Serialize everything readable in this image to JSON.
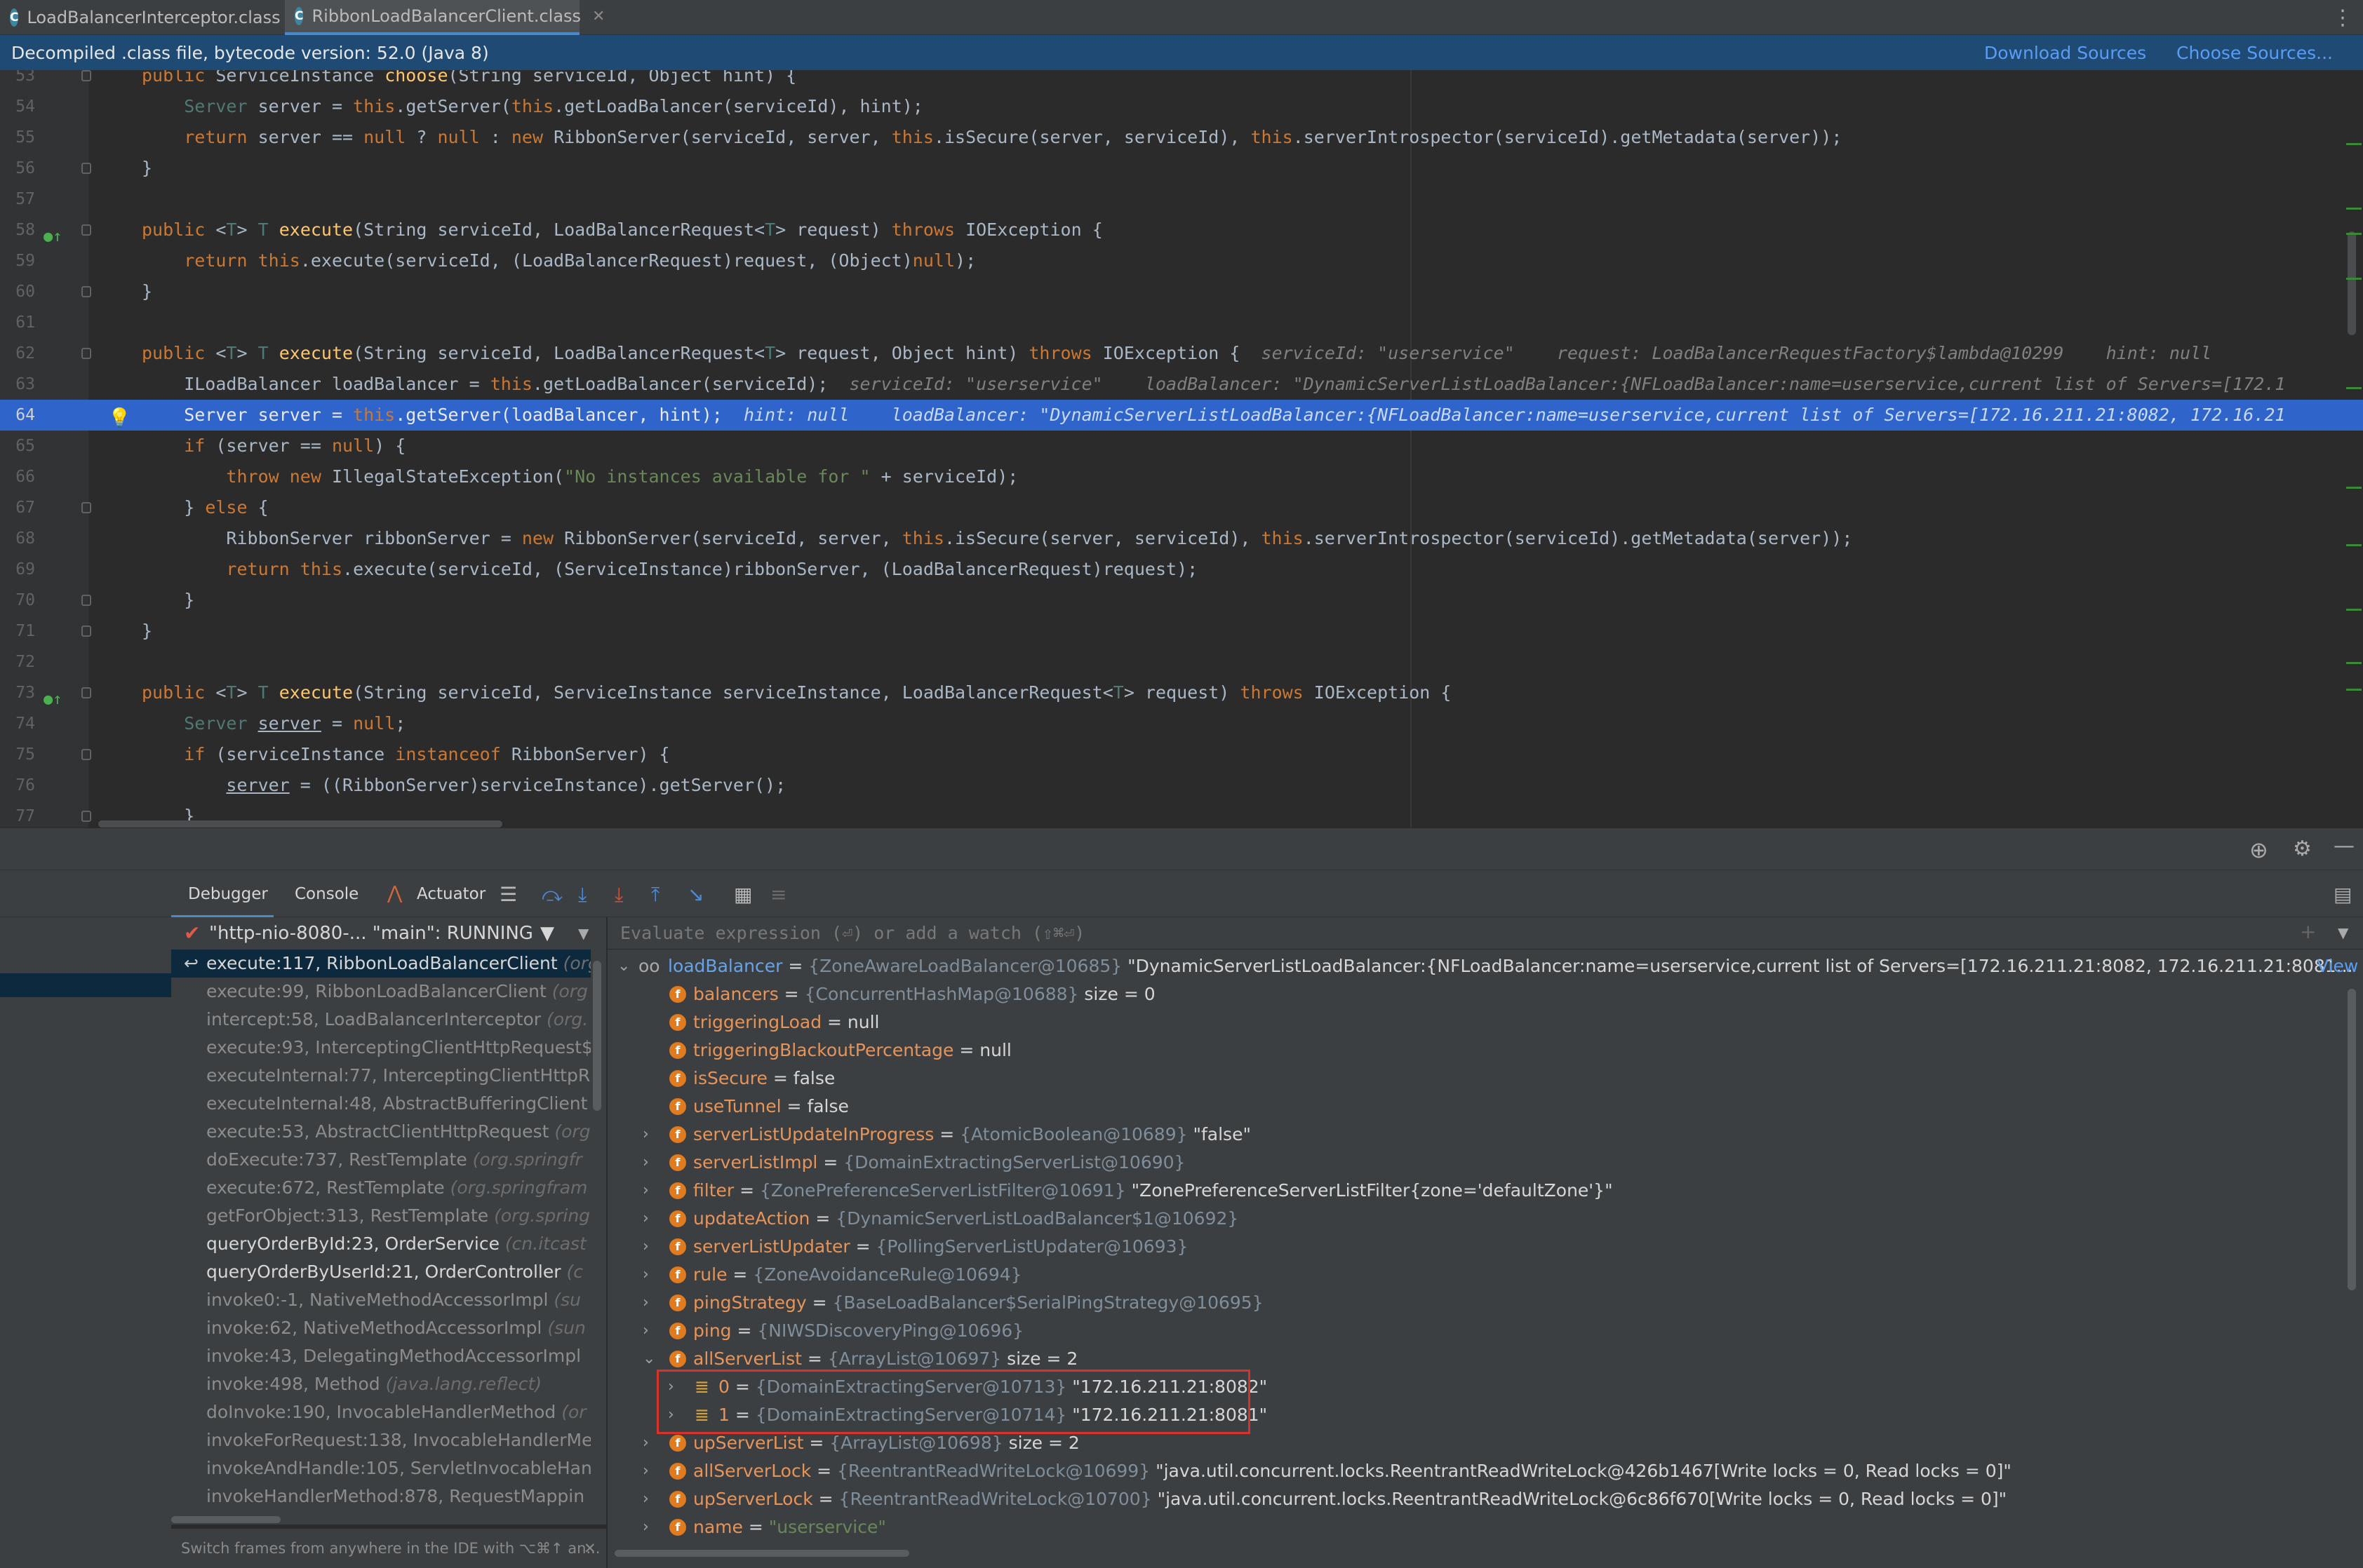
{
  "tabs": [
    {
      "label": "LoadBalancerInterceptor.class"
    },
    {
      "label": "RibbonLoadBalancerClient.class"
    }
  ],
  "banner": {
    "text": "Decompiled .class file, bytecode version: 52.0 (Java 8)",
    "download": "Download Sources",
    "choose": "Choose Sources..."
  },
  "editor": {
    "lines": [
      "53",
      "54",
      "55",
      "56",
      "57",
      "58",
      "59",
      "60",
      "61",
      "62",
      "63",
      "64",
      "65",
      "66",
      "67",
      "68",
      "69",
      "70",
      "71",
      "72",
      "73",
      "74",
      "75",
      "76",
      "77"
    ]
  },
  "debugger": {
    "tabs": {
      "debugger": "Debugger",
      "console": "Console",
      "actuator": "Actuator"
    },
    "thread": "\"http-nio-8080-... \"main\": RUNNING",
    "eval_placeholder": "Evaluate expression (⏎) or add a watch (⇧⌘⏎)",
    "hint": "Switch frames from anywhere in the IDE with ⌥⌘↑ an...",
    "view_link": "View",
    "frames": [
      {
        "name": "execute:117, RibbonLoadBalancerClient",
        "pkg": "(org"
      },
      {
        "name": "execute:99, RibbonLoadBalancerClient",
        "pkg": "(org"
      },
      {
        "name": "intercept:58, LoadBalancerInterceptor",
        "pkg": "(org."
      },
      {
        "name": "execute:93, InterceptingClientHttpRequest$",
        "pkg": ""
      },
      {
        "name": "executeInternal:77, InterceptingClientHttpR",
        "pkg": ""
      },
      {
        "name": "executeInternal:48, AbstractBufferingClient",
        "pkg": ""
      },
      {
        "name": "execute:53, AbstractClientHttpRequest",
        "pkg": "(org"
      },
      {
        "name": "doExecute:737, RestTemplate",
        "pkg": "(org.springfr"
      },
      {
        "name": "execute:672, RestTemplate",
        "pkg": "(org.springfram"
      },
      {
        "name": "getForObject:313, RestTemplate",
        "pkg": "(org.spring"
      },
      {
        "name": "queryOrderById:23, OrderService",
        "pkg": "(cn.itcast"
      },
      {
        "name": "queryOrderByUserId:21, OrderController",
        "pkg": "(c"
      },
      {
        "name": "invoke0:-1, NativeMethodAccessorImpl",
        "pkg": "(su"
      },
      {
        "name": "invoke:62, NativeMethodAccessorImpl",
        "pkg": "(sun"
      },
      {
        "name": "invoke:43, DelegatingMethodAccessorImpl",
        "pkg": ""
      },
      {
        "name": "invoke:498, Method",
        "pkg": "(java.lang.reflect)"
      },
      {
        "name": "doInvoke:190, InvocableHandlerMethod",
        "pkg": "(or"
      },
      {
        "name": "invokeForRequest:138, InvocableHandlerMe",
        "pkg": ""
      },
      {
        "name": "invokeAndHandle:105, ServletInvocableHan",
        "pkg": ""
      },
      {
        "name": "invokeHandlerMethod:878, RequestMappin",
        "pkg": ""
      }
    ],
    "variables": [
      {
        "name": "loadBalancer",
        "type": "{ZoneAwareLoadBalancer@10685}",
        "value": "\"DynamicServerListLoadBalancer:{NFLoadBalancer:name=userservice,current list of Servers=[172.16.211.21:8082, 172.16.211.21:8081..."
      },
      {
        "name": "balancers",
        "type": "{ConcurrentHashMap@10688}",
        "value": "size = 0"
      },
      {
        "name": "triggeringLoad",
        "type": "",
        "value": "= null"
      },
      {
        "name": "triggeringBlackoutPercentage",
        "type": "",
        "value": "= null"
      },
      {
        "name": "isSecure",
        "type": "",
        "value": "= false"
      },
      {
        "name": "useTunnel",
        "type": "",
        "value": "= false"
      },
      {
        "name": "serverListUpdateInProgress",
        "type": "{AtomicBoolean@10689}",
        "value": "\"false\""
      },
      {
        "name": "serverListImpl",
        "type": "{DomainExtractingServerList@10690}",
        "value": ""
      },
      {
        "name": "filter",
        "type": "{ZonePreferenceServerListFilter@10691}",
        "value": "\"ZonePreferenceServerListFilter{zone='defaultZone'}\""
      },
      {
        "name": "updateAction",
        "type": "{DynamicServerListLoadBalancer$1@10692}",
        "value": ""
      },
      {
        "name": "serverListUpdater",
        "type": "{PollingServerListUpdater@10693}",
        "value": ""
      },
      {
        "name": "rule",
        "type": "{ZoneAvoidanceRule@10694}",
        "value": ""
      },
      {
        "name": "pingStrategy",
        "type": "{BaseLoadBalancer$SerialPingStrategy@10695}",
        "value": ""
      },
      {
        "name": "ping",
        "type": "{NIWSDiscoveryPing@10696}",
        "value": ""
      },
      {
        "name": "allServerList",
        "type": "{ArrayList@10697}",
        "value": "size = 2"
      },
      {
        "name": "0",
        "type": "{DomainExtractingServer@10713}",
        "value": "\"172.16.211.21:8082\""
      },
      {
        "name": "1",
        "type": "{DomainExtractingServer@10714}",
        "value": "\"172.16.211.21:8081\""
      },
      {
        "name": "upServerList",
        "type": "{ArrayList@10698}",
        "value": "size = 2"
      },
      {
        "name": "allServerLock",
        "type": "{ReentrantReadWriteLock@10699}",
        "value": "\"java.util.concurrent.locks.ReentrantReadWriteLock@426b1467[Write locks = 0, Read locks = 0]\""
      },
      {
        "name": "upServerLock",
        "type": "{ReentrantReadWriteLock@10700}",
        "value": "\"java.util.concurrent.locks.ReentrantReadWriteLock@6c86f670[Write locks = 0, Read locks = 0]\""
      },
      {
        "name": "name",
        "type": "",
        "value": "\"userservice\""
      }
    ]
  },
  "colors": {
    "accent": "#4a88c7",
    "highlight_line": "#2f65ca",
    "banner": "#1e4a74",
    "highlight_box": "#d9322b"
  }
}
